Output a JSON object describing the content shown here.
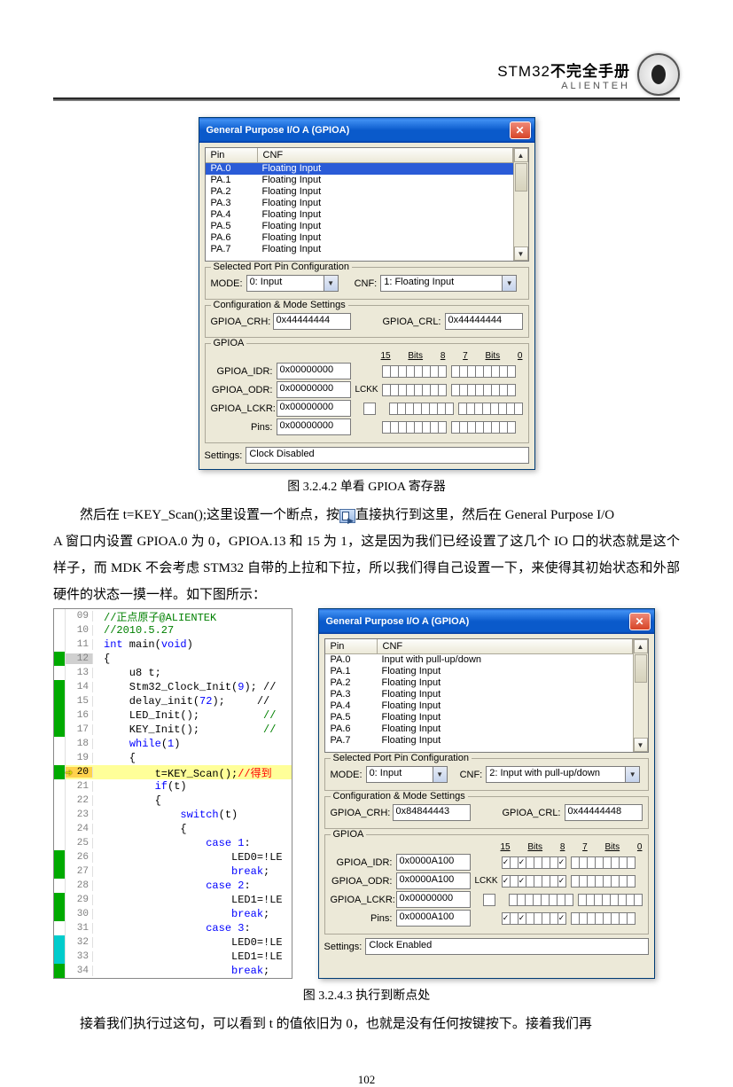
{
  "header": {
    "stm32": "STM32",
    "stm32_suffix": "不完全手册",
    "alienteh": "ALIENTEH"
  },
  "fig1": {
    "title": "General Purpose I/O A (GPIOA)",
    "cols": {
      "pin": "Pin",
      "cnf": "CNF"
    },
    "rows": [
      {
        "pin": "PA.0",
        "cnf": "Floating Input",
        "sel": true
      },
      {
        "pin": "PA.1",
        "cnf": "Floating Input"
      },
      {
        "pin": "PA.2",
        "cnf": "Floating Input"
      },
      {
        "pin": "PA.3",
        "cnf": "Floating Input"
      },
      {
        "pin": "PA.4",
        "cnf": "Floating Input"
      },
      {
        "pin": "PA.5",
        "cnf": "Floating Input"
      },
      {
        "pin": "PA.6",
        "cnf": "Floating Input"
      },
      {
        "pin": "PA.7",
        "cnf": "Floating Input"
      }
    ],
    "sel_group": "Selected Port Pin Configuration",
    "mode_lbl": "MODE:",
    "mode_val": "0: Input",
    "cnf_lbl": "CNF:",
    "cnf_val": "1: Floating Input",
    "cfg_group": "Configuration & Mode Settings",
    "crh_lbl": "GPIOA_CRH:",
    "crh_val": "0x44444444",
    "crl_lbl": "GPIOA_CRL:",
    "crl_val": "0x44444444",
    "gpioa_group": "GPIOA",
    "idr_lbl": "GPIOA_IDR:",
    "idr_val": "0x00000000",
    "odr_lbl": "GPIOA_ODR:",
    "odr_val": "0x00000000",
    "lckr_lbl": "GPIOA_LCKR:",
    "lckr_val": "0x00000000",
    "pins_lbl": "Pins:",
    "pins_val": "0x00000000",
    "lckk_lbl": "LCKK",
    "bits15": "15",
    "bitsL": "Bits",
    "bits8": "8",
    "bits7": "7",
    "bits0": "0",
    "settings_lbl": "Settings:",
    "settings_val": "Clock Disabled"
  },
  "fig1_caption": "图 3.2.4.2    单看 GPIOA 寄存器",
  "para1a": "然后在 t=KEY_Scan();这里设置一个断点，按",
  "para1b": "直接执行到这里，然后在 General Purpose I/O",
  "para2": "A 窗口内设置 GPIOA.0 为 0，GPIOA.13 和 15 为 1，这是因为我们已经设置了这几个 IO 口的状态就是这个样子，而 MDK 不会考虑 STM32 自带的上拉和下拉，所以我们得自己设置一下，来使得其初始状态和外部硬件的状态一摸一样。如下图所示：",
  "code": {
    "l09": "//正点原子@ALIENTEK",
    "l10": "//2010.5.27",
    "l11a": "int",
    "l11b": " main(",
    "l11c": "void",
    "l11d": ")",
    "l12": "{",
    "l13": "    u8 t;",
    "l14a": "    Stm32_Clock_Init(",
    "l14b": "9",
    "l14c": "); //",
    "l15a": "    delay_init(",
    "l15b": "72",
    "l15c": ");     //",
    "l16a": "    LED_Init();          ",
    "l16b": "//",
    "l17a": "    KEY_Init();          ",
    "l17b": "//",
    "l18a": "    ",
    "l18b": "while",
    "l18c": "(",
    "l18d": "1",
    "l18e": ")",
    "l19": "    {",
    "l20a": "        t=KEY_Scan();",
    "l20b": "//得到",
    "l21a": "        ",
    "l21b": "if",
    "l21c": "(t)",
    "l22": "        {",
    "l23a": "            ",
    "l23b": "switch",
    "l23c": "(t)",
    "l24": "            {",
    "l25a": "                ",
    "l25b": "case",
    "l25c": " ",
    "l25d": "1",
    "l25e": ":",
    "l26": "                    LED0=!LE",
    "l27a": "                    ",
    "l27b": "break",
    "l27c": ";",
    "l28a": "                ",
    "l28b": "case",
    "l28c": " ",
    "l28d": "2",
    "l28e": ":",
    "l29": "                    LED1=!LE",
    "l30a": "                    ",
    "l30b": "break",
    "l30c": ";",
    "l31a": "                ",
    "l31b": "case",
    "l31c": " ",
    "l31d": "3",
    "l31e": ":",
    "l32": "                    LED0=!LE",
    "l33": "                    LED1=!LE",
    "l34a": "                    ",
    "l34b": "break",
    "l34c": ";"
  },
  "fig2": {
    "title": "General Purpose I/O A (GPIOA)",
    "cols": {
      "pin": "Pin",
      "cnf": "CNF"
    },
    "rows": [
      {
        "pin": "PA.0",
        "cnf": "Input with pull-up/down"
      },
      {
        "pin": "PA.1",
        "cnf": "Floating Input"
      },
      {
        "pin": "PA.2",
        "cnf": "Floating Input"
      },
      {
        "pin": "PA.3",
        "cnf": "Floating Input"
      },
      {
        "pin": "PA.4",
        "cnf": "Floating Input"
      },
      {
        "pin": "PA.5",
        "cnf": "Floating Input"
      },
      {
        "pin": "PA.6",
        "cnf": "Floating Input"
      },
      {
        "pin": "PA.7",
        "cnf": "Floating Input"
      }
    ],
    "sel_group": "Selected Port Pin Configuration",
    "mode_lbl": "MODE:",
    "mode_val": "0: Input",
    "cnf_lbl": "CNF:",
    "cnf_val": "2: Input with pull-up/down",
    "cfg_group": "Configuration & Mode Settings",
    "crh_lbl": "GPIOA_CRH:",
    "crh_val": "0x84844443",
    "crl_lbl": "GPIOA_CRL:",
    "crl_val": "0x44444448",
    "gpioa_group": "GPIOA",
    "idr_lbl": "GPIOA_IDR:",
    "idr_val": "0x0000A100",
    "odr_lbl": "GPIOA_ODR:",
    "odr_val": "0x0000A100",
    "lckr_lbl": "GPIOA_LCKR:",
    "lckr_val": "0x00000000",
    "pins_lbl": "Pins:",
    "pins_val": "0x0000A100",
    "lckk_lbl": "LCKK",
    "bits15": "15",
    "bitsL": "Bits",
    "bits8": "8",
    "bits7": "7",
    "bits0": "0",
    "settings_lbl": "Settings:",
    "settings_val": "Clock Enabled",
    "idr_bits": [
      "✓",
      "",
      "✓",
      "",
      "",
      "",
      "",
      "✓",
      "",
      "",
      "",
      "",
      "",
      "",
      "",
      ""
    ],
    "odr_bits": [
      "✓",
      "",
      "✓",
      "",
      "",
      "",
      "",
      "✓",
      "",
      "",
      "",
      "",
      "",
      "",
      "",
      ""
    ],
    "pins_bits": [
      "✓",
      "",
      "✓",
      "",
      "",
      "",
      "",
      "✓",
      "",
      "",
      "",
      "",
      "",
      "",
      "",
      ""
    ]
  },
  "fig2_caption": "图 3.2.4.3    执行到断点处",
  "para3": "接着我们执行过这句，可以看到 t 的值依旧为 0，也就是没有任何按键按下。接着我们再",
  "page_number": "102"
}
